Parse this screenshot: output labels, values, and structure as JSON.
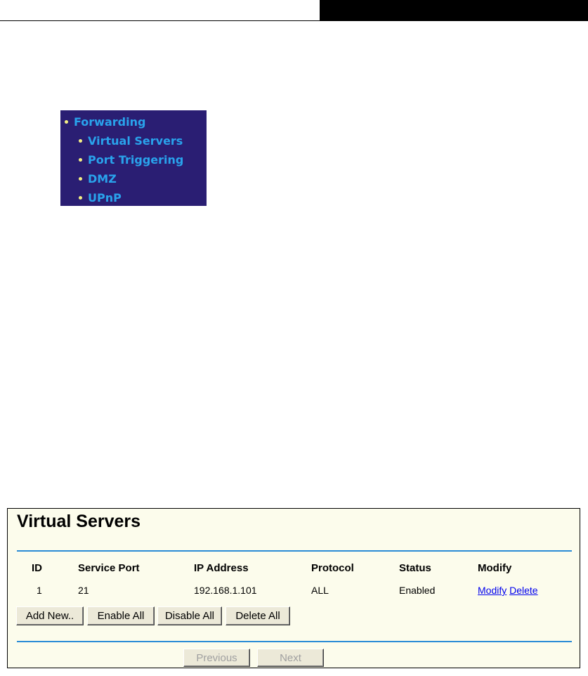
{
  "menu": {
    "parent_label": "Forwarding",
    "items": [
      {
        "label": "Virtual Servers"
      },
      {
        "label": "Port Triggering"
      },
      {
        "label": "DMZ"
      },
      {
        "label": "UPnP"
      }
    ]
  },
  "panel": {
    "title": "Virtual Servers",
    "columns": [
      "ID",
      "Service Port",
      "IP Address",
      "Protocol",
      "Status",
      "Modify"
    ],
    "rows": [
      {
        "id": "1",
        "service_port": "21",
        "ip_address": "192.168.1.101",
        "protocol": "ALL",
        "status": "Enabled",
        "modify_label": "Modify",
        "delete_label": "Delete"
      }
    ],
    "buttons": {
      "add_new": "Add New..",
      "enable_all": "Enable All",
      "disable_all": "Disable All",
      "delete_all": "Delete All"
    },
    "pagination": {
      "previous": "Previous",
      "next": "Next"
    }
  },
  "colors": {
    "menu_bg": "#2a1e73",
    "menu_text": "#29a3ec",
    "bullet": "#f4ef85",
    "panel_bg": "#fcfcec",
    "rule": "#2a8bd6",
    "link": "#0000ee"
  }
}
